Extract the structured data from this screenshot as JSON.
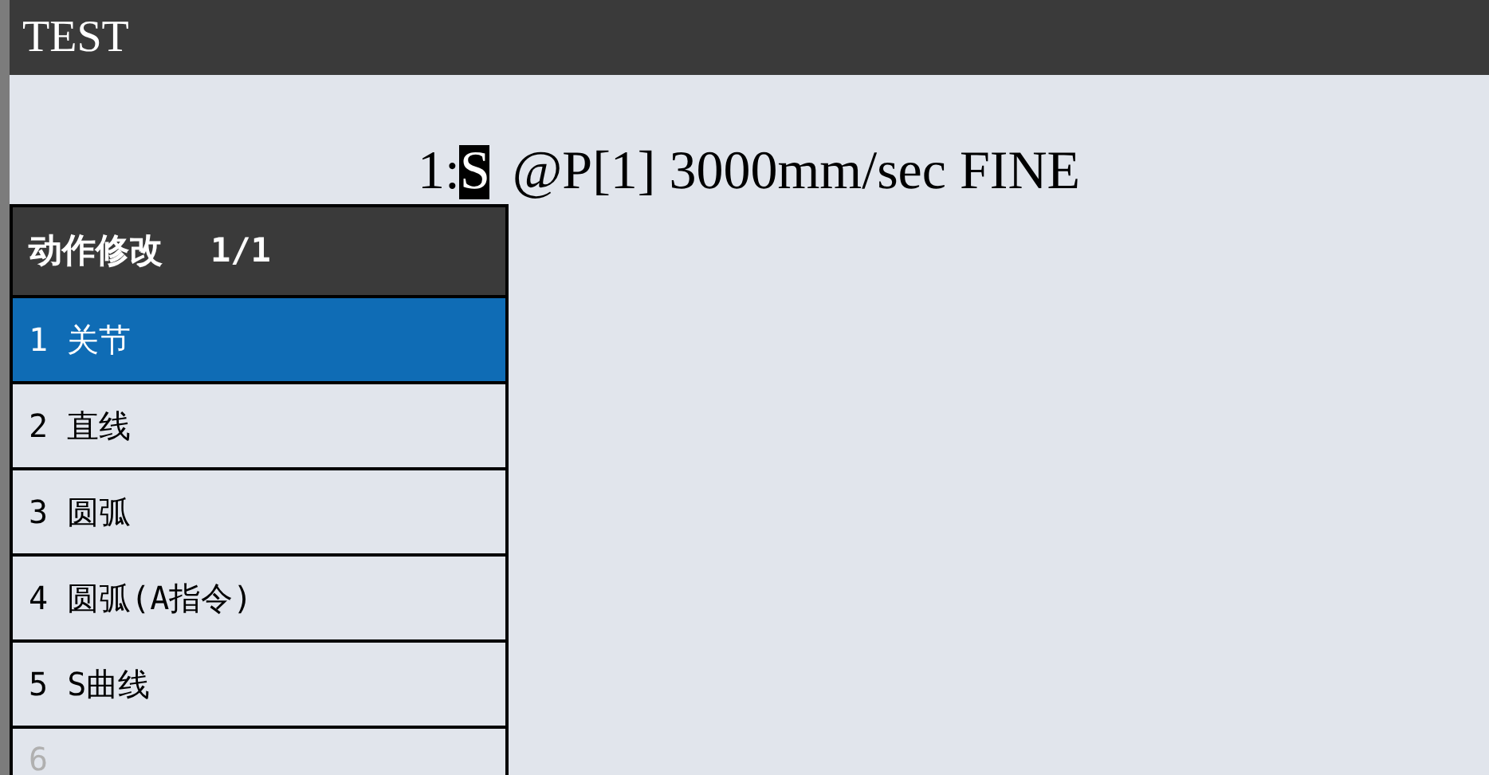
{
  "window": {
    "title": "TEST"
  },
  "program_line": {
    "line_number": "1:",
    "cursor": "S",
    "rest": "@P[1] 3000mm/sec FINE"
  },
  "popup_menu": {
    "title": "动作修改",
    "page": "1/1",
    "items": [
      {
        "label": "1 关节",
        "selected": true,
        "disabled": false
      },
      {
        "label": "2 直线",
        "selected": false,
        "disabled": false
      },
      {
        "label": "3 圆弧",
        "selected": false,
        "disabled": false
      },
      {
        "label": "4 圆弧(A指令)",
        "selected": false,
        "disabled": false
      },
      {
        "label": "5 S曲线",
        "selected": false,
        "disabled": false
      },
      {
        "label": "6",
        "selected": false,
        "disabled": true
      }
    ]
  }
}
